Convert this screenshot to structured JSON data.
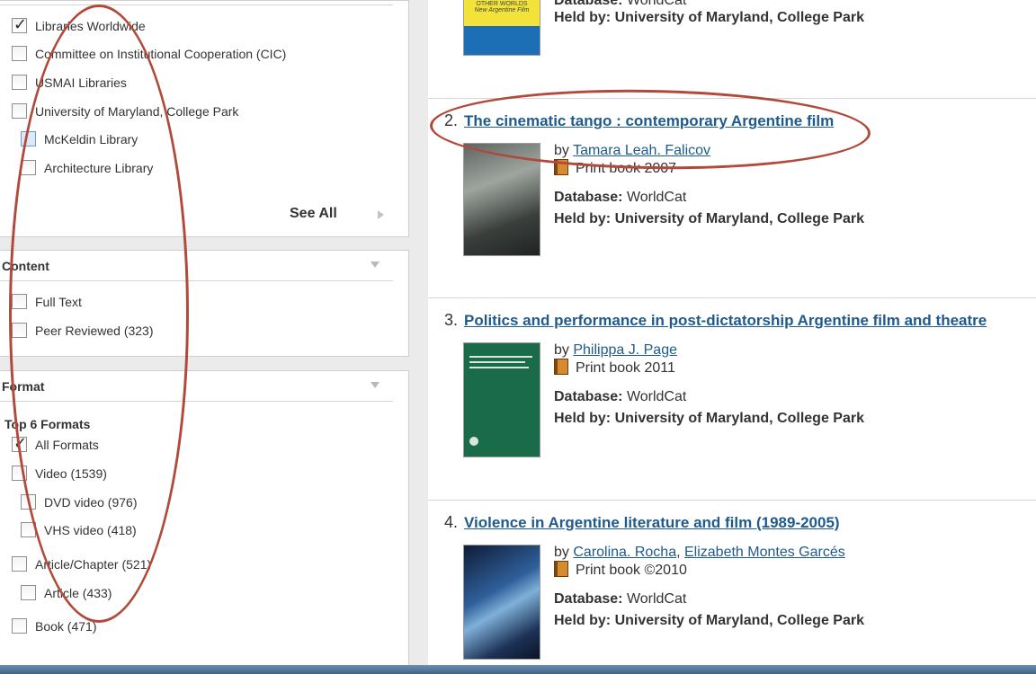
{
  "sidebar": {
    "library_filters": [
      {
        "label": "Libraries Worldwide",
        "checked": true
      },
      {
        "label": "Committee on Institutional Cooperation (CIC)",
        "checked": false
      },
      {
        "label": "USMAI Libraries",
        "checked": false
      },
      {
        "label": "University of Maryland, College Park",
        "checked": false
      },
      {
        "label": "McKeldin Library",
        "checked": false
      },
      {
        "label": "Architecture Library",
        "checked": false
      }
    ],
    "see_all_label": "See All",
    "content": {
      "title": "Content",
      "options": [
        {
          "label": "Full Text",
          "checked": false
        },
        {
          "label": "Peer Reviewed (323)",
          "checked": false
        }
      ]
    },
    "format": {
      "title": "Format",
      "subheading": "Top 6 Formats",
      "options": [
        {
          "label": "All Formats",
          "checked": true
        },
        {
          "label": "Video (1539)",
          "checked": false
        },
        {
          "label": "DVD video (976)",
          "checked": false
        },
        {
          "label": "VHS video (418)",
          "checked": false
        },
        {
          "label": "Article/Chapter (521)",
          "checked": false
        },
        {
          "label": "Article (433)",
          "checked": false
        },
        {
          "label": "Book (471)",
          "checked": false
        }
      ]
    }
  },
  "results": {
    "top_partial": {
      "cover_text_1": "OTHER WORLDS",
      "cover_text_2": "New Argentine Film",
      "database_label": "Database:",
      "database_value": "WorldCat",
      "held_by": "Held by: University of Maryland, College Park"
    },
    "items": [
      {
        "number": "2.",
        "title": "The cinematic tango : contemporary Argentine film",
        "by_prefix": "by",
        "authors": [
          "Tamara Leah. Falicov"
        ],
        "format": "Print book 2007",
        "database_label": "Database:",
        "database_value": "WorldCat",
        "held_by": "Held by: University of Maryland, College Park"
      },
      {
        "number": "3.",
        "title": "Politics and performance in post-dictatorship Argentine film and theatre",
        "by_prefix": "by",
        "authors": [
          "Philippa J. Page"
        ],
        "format": "Print book 2011",
        "database_label": "Database:",
        "database_value": "WorldCat",
        "held_by": "Held by: University of Maryland, College Park"
      },
      {
        "number": "4.",
        "title": "Violence in Argentine literature and film (1989-2005)",
        "by_prefix": "by",
        "authors": [
          "Carolina. Rocha",
          "Elizabeth Montes Garcés"
        ],
        "author_separator": ",",
        "format": "Print book ©2010",
        "database_label": "Database:",
        "database_value": "WorldCat",
        "held_by": "Held by: University of Maryland, College Park"
      }
    ]
  },
  "colors": {
    "link": "#1f5a8c",
    "annotation": "#b14a3a",
    "sidebar_bg": "#ebebeb"
  }
}
